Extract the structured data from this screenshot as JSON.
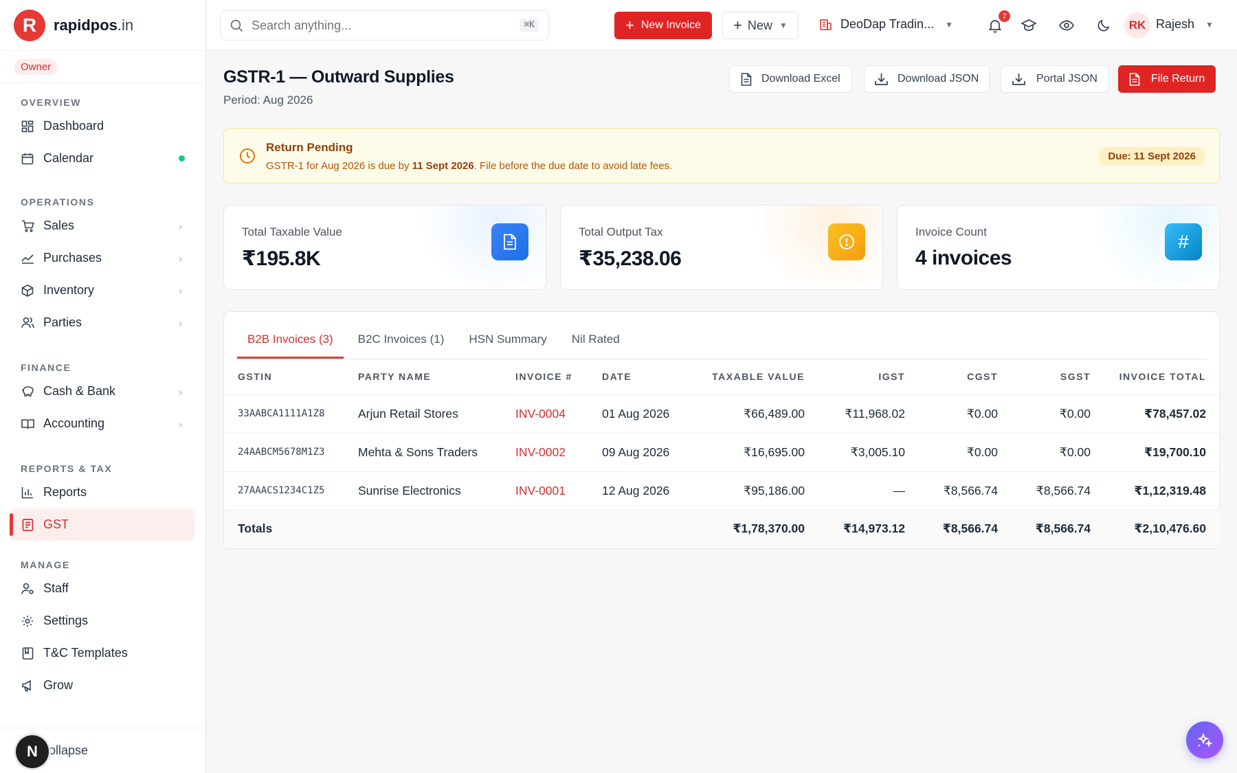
{
  "brand": {
    "name": "rapidpos",
    "tld": ".in",
    "logo_letter": "R"
  },
  "role": "Owner",
  "nav": {
    "sections": {
      "overview": "OVERVIEW",
      "operations": "OPERATIONS",
      "finance": "FINANCE",
      "reports": "REPORTS & TAX",
      "manage": "MANAGE"
    },
    "dashboard": "Dashboard",
    "calendar": "Calendar",
    "sales": "Sales",
    "purchases": "Purchases",
    "inventory": "Inventory",
    "parties": "Parties",
    "cash_bank": "Cash & Bank",
    "accounting": "Accounting",
    "reports": "Reports",
    "gst": "GST",
    "staff": "Staff",
    "settings": "Settings",
    "tc_templates": "T&C Templates",
    "grow": "Grow",
    "collapse": "Collapse"
  },
  "topbar": {
    "search_placeholder": "Search anything...",
    "search_shortcut": "⌘K",
    "new_invoice": "New Invoice",
    "new": "New",
    "company": "DeoDap Tradin...",
    "notification_count": "7",
    "user_initials": "RK",
    "user_name": "Rajesh"
  },
  "page": {
    "title": "GSTR-1 — Outward Supplies",
    "period": "Period: Aug 2026",
    "actions": {
      "download_excel": "Download Excel",
      "download_json": "Download JSON",
      "portal_json": "Portal JSON",
      "file_return": "File Return"
    }
  },
  "alert": {
    "title": "Return Pending",
    "body_prefix": "GSTR-1 for Aug 2026 is due by ",
    "body_date": "11 Sept 2026",
    "body_suffix": ". File before the due date to avoid late fees.",
    "due_badge": "Due: 11 Sept 2026"
  },
  "cards": {
    "taxable": {
      "label": "Total Taxable Value",
      "value": "₹195.8K"
    },
    "output_tax": {
      "label": "Total Output Tax",
      "value": "₹35,238.06"
    },
    "count": {
      "label": "Invoice Count",
      "value": "4 invoices"
    }
  },
  "tabs": {
    "b2b": "B2B Invoices (3)",
    "b2c": "B2C Invoices (1)",
    "hsn": "HSN Summary",
    "nil": "Nil Rated"
  },
  "table": {
    "headers": {
      "gstin": "GSTIN",
      "party": "PARTY NAME",
      "invoice": "INVOICE #",
      "date": "DATE",
      "taxable": "TAXABLE VALUE",
      "igst": "IGST",
      "cgst": "CGST",
      "sgst": "SGST",
      "total": "INVOICE TOTAL"
    },
    "rows": [
      {
        "gstin": "33AABCA1111A1Z8",
        "party": "Arjun Retail Stores",
        "invoice": "INV-0004",
        "date": "01 Aug 2026",
        "taxable": "₹66,489.00",
        "igst": "₹11,968.02",
        "cgst": "₹0.00",
        "sgst": "₹0.00",
        "total": "₹78,457.02"
      },
      {
        "gstin": "24AABCM5678M1Z3",
        "party": "Mehta & Sons Traders",
        "invoice": "INV-0002",
        "date": "09 Aug 2026",
        "taxable": "₹16,695.00",
        "igst": "₹3,005.10",
        "cgst": "₹0.00",
        "sgst": "₹0.00",
        "total": "₹19,700.10"
      },
      {
        "gstin": "27AAACS1234C1Z5",
        "party": "Sunrise Electronics",
        "invoice": "INV-0001",
        "date": "12 Aug 2026",
        "taxable": "₹95,186.00",
        "igst": "—",
        "cgst": "₹8,566.74",
        "sgst": "₹8,566.74",
        "total": "₹1,12,319.48"
      }
    ],
    "totals": {
      "label": "Totals",
      "taxable": "₹1,78,370.00",
      "igst": "₹14,973.12",
      "cgst": "₹8,566.74",
      "sgst": "₹8,566.74",
      "total": "₹2,10,476.60"
    }
  },
  "colors": {
    "accent": "#e02424",
    "warning_bg": "#fefce8",
    "card_blue": "#1d6fe6",
    "card_orange": "#f59e0b",
    "card_sky": "#0ea5e9"
  }
}
